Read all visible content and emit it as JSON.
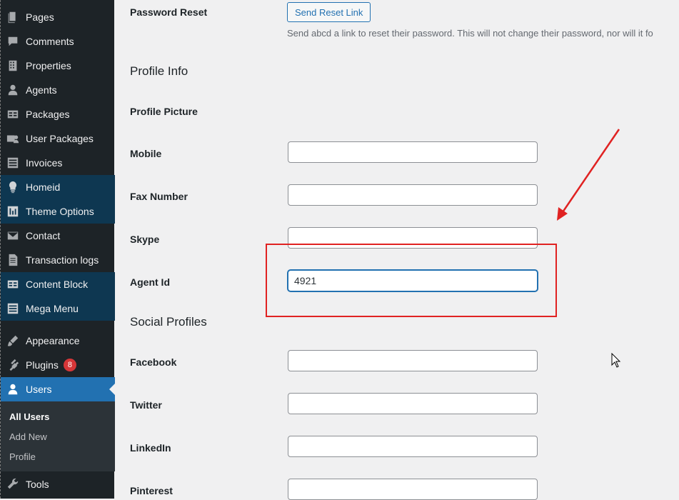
{
  "sidebar": {
    "items": [
      {
        "label": "Pages",
        "icon": "pages-icon"
      },
      {
        "label": "Comments",
        "icon": "comments-icon"
      },
      {
        "label": "Properties",
        "icon": "properties-icon"
      },
      {
        "label": "Agents",
        "icon": "agents-icon"
      },
      {
        "label": "Packages",
        "icon": "packages-icon"
      },
      {
        "label": "User Packages",
        "icon": "user-packages-icon"
      },
      {
        "label": "Invoices",
        "icon": "invoices-icon"
      },
      {
        "label": "Homeid",
        "icon": "lightbulb-icon"
      },
      {
        "label": "Theme Options",
        "icon": "theme-options-icon"
      },
      {
        "label": "Contact",
        "icon": "envelope-icon"
      },
      {
        "label": "Transaction logs",
        "icon": "transaction-logs-icon"
      },
      {
        "label": "Content Block",
        "icon": "content-block-icon"
      },
      {
        "label": "Mega Menu",
        "icon": "mega-menu-icon"
      },
      {
        "label": "Appearance",
        "icon": "brush-icon"
      },
      {
        "label": "Plugins",
        "icon": "plugin-icon",
        "badge": "8"
      },
      {
        "label": "Users",
        "icon": "user-icon"
      },
      {
        "label": "Tools",
        "icon": "wrench-icon"
      }
    ],
    "submenu": [
      "All Users",
      "Add New",
      "Profile"
    ]
  },
  "main": {
    "password_reset": {
      "label": "Password Reset",
      "button": "Send Reset Link",
      "description": "Send abcd a link to reset their password. This will not change their password, nor will it fo"
    },
    "profile_info": {
      "heading": "Profile Info",
      "profile_picture_label": "Profile Picture",
      "mobile": {
        "label": "Mobile",
        "value": ""
      },
      "fax": {
        "label": "Fax Number",
        "value": ""
      },
      "skype": {
        "label": "Skype",
        "value": ""
      },
      "agent_id": {
        "label": "Agent Id",
        "value": "4921"
      }
    },
    "social_profiles": {
      "heading": "Social Profiles",
      "facebook": {
        "label": "Facebook",
        "value": ""
      },
      "twitter": {
        "label": "Twitter",
        "value": ""
      },
      "linkedin": {
        "label": "LinkedIn",
        "value": ""
      },
      "pinterest": {
        "label": "Pinterest",
        "value": ""
      }
    }
  },
  "colors": {
    "sidebar_bg": "#1d2327",
    "highlight_bg": "#0e3751",
    "active_bg": "#2271b1",
    "annotation_red": "#e02222",
    "badge_red": "#d63638"
  }
}
